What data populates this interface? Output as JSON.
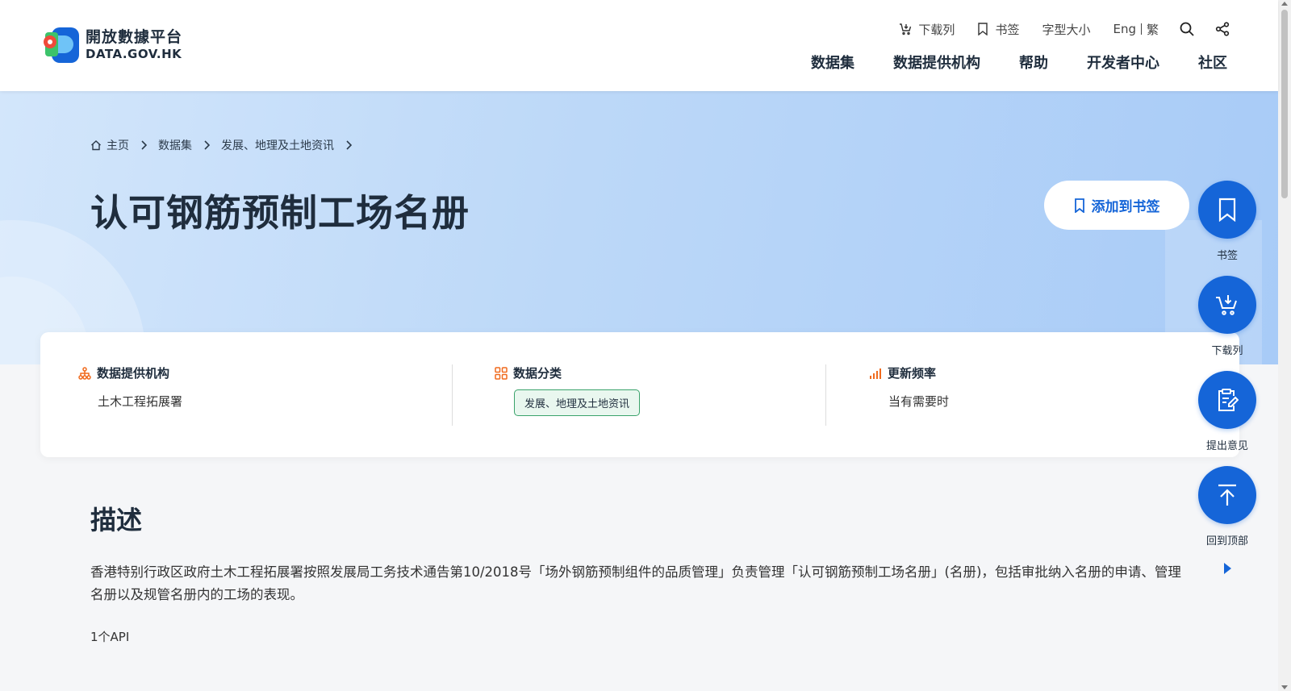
{
  "header": {
    "logo_cn": "開放數據平台",
    "logo_en": "DATA.GOV.HK",
    "utility": {
      "download_list": "下载列",
      "bookmark": "书签",
      "font_size": "字型大小",
      "lang_en": "Eng",
      "lang_tc": "繁"
    },
    "nav": [
      "数据集",
      "数据提供机构",
      "帮助",
      "开发者中心",
      "社区"
    ]
  },
  "breadcrumb": [
    "主页",
    "数据集",
    "发展、地理及土地资讯"
  ],
  "page_title": "认可钢筋预制工场名册",
  "add_bookmark": "添加到书签",
  "info": {
    "provider_label": "数据提供机构",
    "provider_value": "土木工程拓展署",
    "category_label": "数据分类",
    "category_value": "发展、地理及土地资讯",
    "frequency_label": "更新频率",
    "frequency_value": "当有需要时"
  },
  "description": {
    "title": "描述",
    "text": "香港特别行政区政府土木工程拓展署按照发展局工务技术通告第10/2018号「场外钢筋预制组件的品质管理」负责管理「认可钢筋预制工场名册」(名册)，包括审批纳入名册的申请、管理名册以及规管名册内的工场的表现。",
    "api_count": "1个API"
  },
  "fabs": {
    "bookmark": "书签",
    "download_list": "下载列",
    "feedback": "提出意见",
    "back_to_top": "回到顶部"
  },
  "colors": {
    "primary": "#1565d8",
    "accent_orange": "#f06a1d",
    "tag_green": "#3aa36b"
  }
}
